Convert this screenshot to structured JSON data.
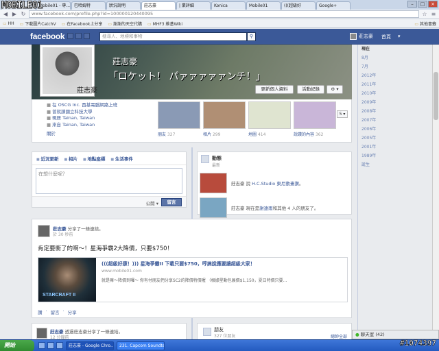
{
  "browser": {
    "tabs": [
      "facebook",
      "Mobile01 - 專...",
      "巴哈姆特",
      "狀況說明",
      "莊志豪",
      "| 業詳細",
      "Konica",
      "Mobile01",
      "(((超級好",
      "Google+"
    ],
    "active_tab_index": 4,
    "url": "www.facebook.com/profile.php?id=100000120440095",
    "bookmarks": [
      "HH",
      "下載圖片CatchV",
      "在Facebook上分享",
      "謝謝的天空代購",
      "MHF3 維基Wiki"
    ],
    "bookmarks_right": "其他書籤"
  },
  "fb_bar": {
    "logo": "facebook",
    "search_placeholder": "搜尋人、地標和事物",
    "user_name": "莊志豪",
    "home_label": "首頁"
  },
  "cover": {
    "name_overlay": "莊志豪",
    "caption": "「ロケット！ パァァァァァンチ！」"
  },
  "profile": {
    "name": "莊志豪",
    "update_info_button": "更新個人資料",
    "activity_log_button": "活動紀錄",
    "settings_button": "⚙ ▾",
    "info": [
      "在 OSCG Inc. 西基電腦網路上班",
      "曾就讀國立科技大學",
      "現居 Tainan, Taiwan",
      "來自 Tainan, Taiwan"
    ],
    "about_link": "關於"
  },
  "thumbnails": [
    {
      "label": "朋友",
      "count": "327",
      "color": "#8a9ab5"
    },
    {
      "label": "相片",
      "count": "299",
      "color": "#b08f74"
    },
    {
      "label": "地圖",
      "count": "414",
      "color": "#dfe4d0"
    },
    {
      "label": "說讚的內容",
      "count": "362",
      "color": "#c9b6d8"
    }
  ],
  "thumbs_more": "5 ▾",
  "composer": {
    "tabs": [
      "近況更新",
      "相片",
      "地點座標",
      "生活事件"
    ],
    "placeholder": "在想什麼呢？",
    "privacy": "公開 ▾",
    "post_button": "留言"
  },
  "activity": {
    "title": "動態",
    "subtitle": "最新",
    "items": [
      {
        "text_pre": "莊志豪 說 ",
        "highlight": "H.C.Studio 東尼動畫讚",
        "text_post": "。",
        "color": "#b84b3c"
      },
      {
        "text_pre": "莊志豪 現在是",
        "highlight": "謝遠雨",
        "text_post": "和其他 4 人的朋友了。",
        "color": "#7aa6c2"
      }
    ]
  },
  "timeline_nav": [
    "現在",
    "8月",
    "7月",
    "2012年",
    "2011年",
    "2010年",
    "2009年",
    "2008年",
    "2007年",
    "2006年",
    "2005年",
    "2001年",
    "1989年",
    "誕生"
  ],
  "post": {
    "author": "莊志豪",
    "action": "分享了一條連結。",
    "time": "於 30 秒前",
    "text": "肯定要衝了的啊～！星海爭霸2大降價，只要$750！",
    "link_title": "(((超級好康！))) 星海爭霸II 下載只要$750，哼搞說應要讓超級大家！",
    "link_url": "www.mobile01.com",
    "link_desc": "就是嘛～降價到囉～ 你有付朋友們分享SC2的降價特價喔 （根據星動包展價$1,150，夏日特價只要...",
    "link_image_text": "STARCRAFT II",
    "actions": [
      "讚",
      "留言",
      "分享"
    ]
  },
  "post2": {
    "author": "莊志豪",
    "action": "透過莊志豪分享了一條連結。",
    "time": "12 分鐘前"
  },
  "friends_box": {
    "title": "朋友",
    "count": "327 位朋友",
    "right": "總帥全部"
  },
  "chat": {
    "label": "聊天室 (42)"
  },
  "taskbar": {
    "start": "開始",
    "tasks": [
      "莊志豪 - Google Chro...",
      "231. Capcom Soundte..."
    ]
  },
  "watermark": {
    "logo": "MOBILE01",
    "id": "#1074397"
  }
}
